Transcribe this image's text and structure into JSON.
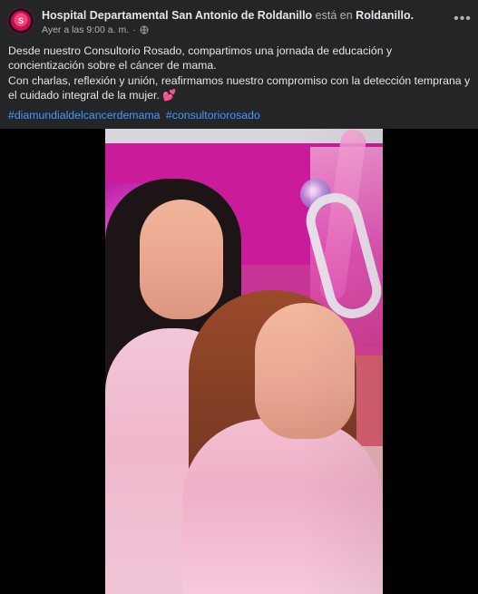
{
  "post": {
    "page_name": "Hospital Departamental San Antonio de Roldanillo",
    "location_connector": "está en",
    "location": "Roldanillo.",
    "timestamp": "Ayer a las 9:00 a. m.",
    "separator": "·",
    "more_label": "•••",
    "text": {
      "line1": "Desde nuestro Consultorio Rosado, compartimos una jornada de educación y concientización sobre el cáncer de mama.",
      "line2": "Con charlas, reflexión y unión, reafirmamos nuestro compromiso con la detección temprana y el cuidado integral de la mujer. 💕"
    },
    "hashtags": [
      "#diamundialdelcancerdemama",
      "#consultoriorosado"
    ],
    "media_type": "video/photo",
    "avatar_text": "S"
  },
  "icons": {
    "globe": "globe-icon",
    "more": "more-options-icon"
  },
  "colors": {
    "background": "#242526",
    "text": "#e4e6eb",
    "muted": "#b0b3b8",
    "hashtag": "#4599ff",
    "avatar_accent": "#ff3e7e"
  }
}
